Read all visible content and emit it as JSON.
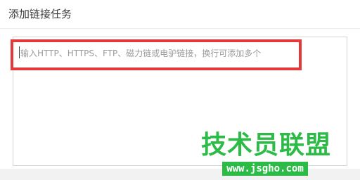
{
  "dialog": {
    "title": "添加链接任务"
  },
  "url_input": {
    "value": "",
    "placeholder": "输入HTTP、HTTPS、FTP、磁力链或电驴链接，换行可添加多个"
  },
  "watermark": {
    "main_text": "技术员联盟",
    "url_text": "www.jsgho.com"
  },
  "colors": {
    "highlight": "#e23a3a",
    "watermark": "#2dbb48"
  }
}
